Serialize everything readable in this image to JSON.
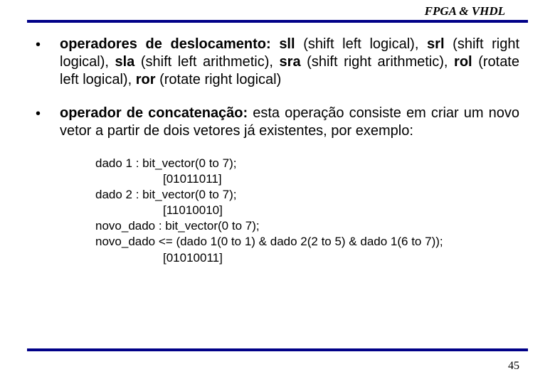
{
  "header": {
    "title": "FPGA & VHDL"
  },
  "bullets": [
    {
      "lead": "operadores de deslocamento:",
      "segments": [
        {
          "op": "sll",
          "desc": "(shift left logical),"
        },
        {
          "op": "srl",
          "desc": "(shift right logical),"
        },
        {
          "op": "sla",
          "desc": "(shift left arithmetic),"
        },
        {
          "op": "sra",
          "desc": "(shift right arithmetic),"
        },
        {
          "op": "rol",
          "desc": "(rotate left logical),"
        },
        {
          "op": "ror",
          "desc": "(rotate right logical)"
        }
      ]
    },
    {
      "lead": "operador de concatenação:",
      "tail": " esta operação consiste em criar um novo vetor a partir de dois vetores já existentes, por exemplo:"
    }
  ],
  "code": [
    {
      "text": "dado 1 : bit_vector(0 to 7);",
      "indent": false
    },
    {
      "text": "[01011011]",
      "indent": true
    },
    {
      "text": "dado 2 : bit_vector(0 to 7);",
      "indent": false
    },
    {
      "text": "[11010010]",
      "indent": true
    },
    {
      "text": "novo_dado : bit_vector(0 to 7);",
      "indent": false
    },
    {
      "text": "novo_dado <= (dado 1(0 to 1) & dado 2(2 to 5) & dado 1(6 to 7));",
      "indent": false
    },
    {
      "text": "[01010011]",
      "indent": true
    }
  ],
  "page_number": "45",
  "bullet_glyph": "•"
}
